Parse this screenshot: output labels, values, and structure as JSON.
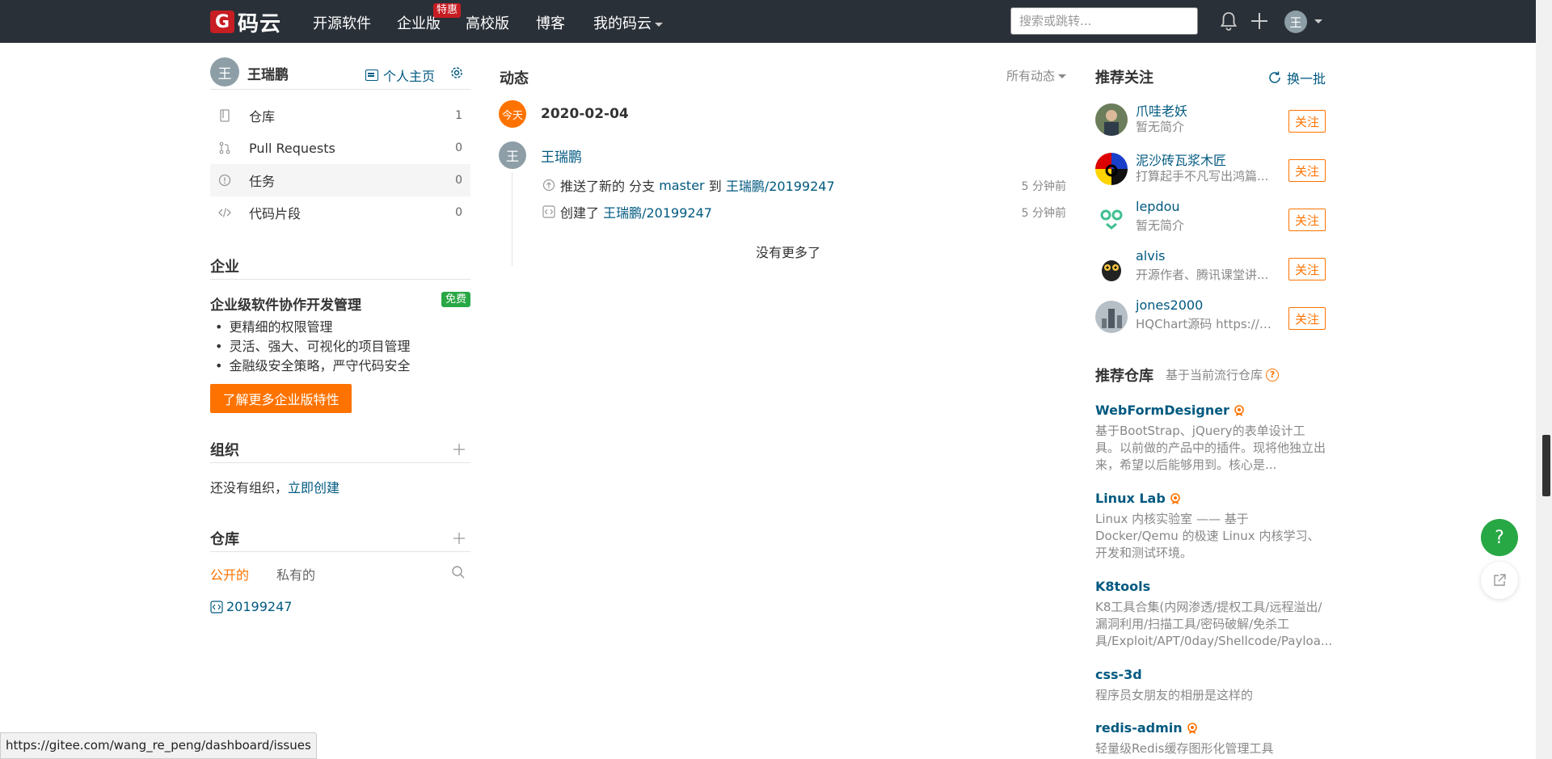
{
  "colors": {
    "nav_bg": "#2a3038",
    "brand": "#c71d23",
    "accent": "#fe7300",
    "link": "#005980",
    "success": "#28a745"
  },
  "nav": {
    "logo_mark": "G",
    "logo_text": "码云",
    "items": [
      "开源软件",
      "企业版",
      "高校版",
      "博客",
      "我的码云"
    ],
    "hot_badge": "特惠",
    "search_placeholder": "搜索或跳转...",
    "avatar_initial": "王"
  },
  "left": {
    "avatar_initial": "王",
    "user_name": "王瑞鹏",
    "homepage_label": "个人主页",
    "menu": [
      {
        "label": "仓库",
        "count": "1",
        "icon": "repo-icon"
      },
      {
        "label": "Pull Requests",
        "count": "0",
        "icon": "pull-request-icon"
      },
      {
        "label": "任务",
        "count": "0",
        "icon": "issue-icon"
      },
      {
        "label": "代码片段",
        "count": "0",
        "icon": "code-snippet-icon"
      }
    ],
    "enterprise": {
      "title": "企业",
      "subtitle": "企业级软件协作开发管理",
      "badge": "免费",
      "features": [
        "更精细的权限管理",
        "灵活、强大、可视化的项目管理",
        "金融级安全策略，严守代码安全"
      ],
      "button": "了解更多企业版特性"
    },
    "org": {
      "title": "组织",
      "empty_text": "还没有组织，",
      "create_link": "立即创建"
    },
    "repos": {
      "title": "仓库",
      "tab_public": "公开的",
      "tab_private": "私有的",
      "items": [
        "20199247"
      ]
    }
  },
  "middle": {
    "title": "动态",
    "filter": "所有动态",
    "today_badge": "今天",
    "date": "2020-02-04",
    "avatar_initial": "王",
    "user": "王瑞鹏",
    "activities": [
      {
        "prefix": "推送了新的 分支",
        "branch": "master",
        "mid": "到",
        "repo": "王瑞鹏/20199247",
        "time": "5 分钟前"
      },
      {
        "prefix": "创建了",
        "repo": "王瑞鹏/20199247",
        "time": "5 分钟前"
      }
    ],
    "no_more": "没有更多了"
  },
  "right": {
    "follow_title": "推荐关注",
    "refresh": "换一批",
    "follow_label": "关注",
    "users": [
      {
        "name": "爪哇老妖",
        "desc": "暂无简介"
      },
      {
        "name": "泥沙砖瓦浆木匠",
        "desc": "打算起手不凡写出鸿篇..."
      },
      {
        "name": "lepdou",
        "desc": "暂无简介"
      },
      {
        "name": "alvis",
        "desc": "开源作者、腾讯课堂讲..."
      },
      {
        "name": "jones2000",
        "desc": "HQChart源码 https://gi..."
      }
    ],
    "repo_title": "推荐仓库",
    "repo_subtitle": "基于当前流行仓库",
    "repos": [
      {
        "name": "WebFormDesigner",
        "desc": "基于BootStrap、jQuery的表单设计工具。以前做的产品中的插件。现将他独立出来，希望以后能够用到。核心是...",
        "gvp": true
      },
      {
        "name": "Linux Lab",
        "desc": "Linux 内核实验室 —— 基于 Docker/Qemu 的极速 Linux 内核学习、开发和测试环境。",
        "gvp": true
      },
      {
        "name": "K8tools",
        "desc": "K8工具合集(内网渗透/提权工具/远程溢出/漏洞利用/扫描工具/密码破解/免杀工具/Exploit/APT/0day/Shellcode/Payloa...",
        "gvp": false
      },
      {
        "name": "css-3d",
        "desc": "程序员女朋友的相册是这样的",
        "gvp": false
      },
      {
        "name": "redis-admin",
        "desc": "轻量级Redis缓存图形化管理工具",
        "gvp": true
      }
    ]
  },
  "fab": {
    "help": "?"
  },
  "status_url": "https://gitee.com/wang_re_peng/dashboard/issues"
}
